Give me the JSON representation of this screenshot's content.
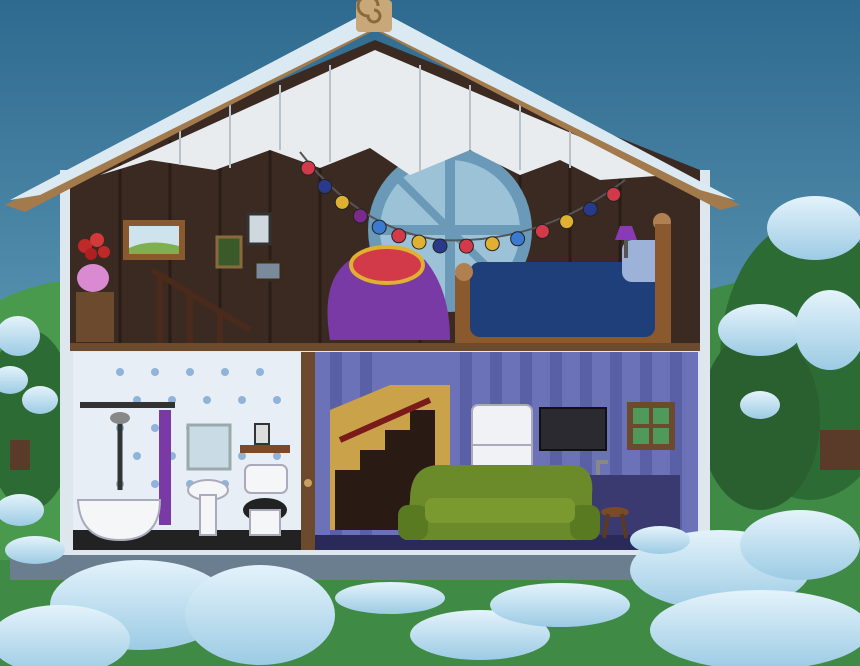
{
  "scene": {
    "title": "",
    "colors": {
      "sky_top": "#2e6a8f",
      "sky_bottom": "#7fb8cf",
      "hill": "#3f8a45",
      "hill_dark": "#2d6b34",
      "snow": "#cfe8f5",
      "snow_shadow": "#8fc4e0",
      "attic_wall": "#3b2a22",
      "roof_siding": "#e8ecef",
      "roof_trim": "#a37a4c",
      "bathroom_wall": "#e7eef6",
      "living_wall": "#6b72b8",
      "living_stripe": "#5a60a6",
      "floor_beam": "#6b4a2e",
      "sofa": "#6b8a2a",
      "beanbag": "#7a3aa6",
      "bedspread": "#1f3f7a",
      "fridge": "#f0f2f5",
      "stairs_wall": "#c9a24a"
    },
    "lights": [
      "#d23a4a",
      "#2a3a8a",
      "#e0b030",
      "#7a2a8a",
      "#3a7ad0",
      "#d23a4a",
      "#e0b030",
      "#2a3a8a",
      "#d23a4a",
      "#e0b030",
      "#3a7ad0",
      "#d23a4a",
      "#e0b030",
      "#2a3a8a",
      "#d23a4a"
    ],
    "icons": {
      "roof_knot": "swirl-icon",
      "window": "round-window-icon"
    }
  }
}
